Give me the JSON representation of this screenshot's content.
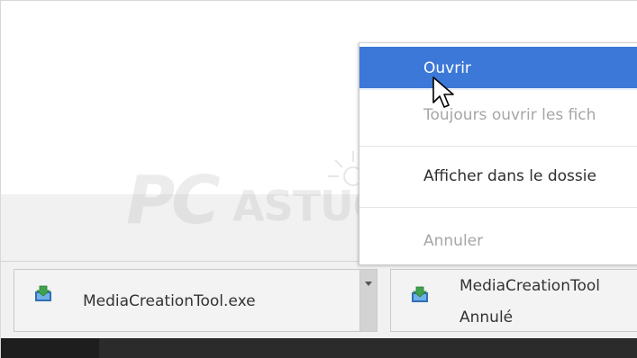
{
  "context_menu": {
    "open": "Ouvrir",
    "always_open": "Toujours ouvrir les fich",
    "show_in_folder": "Afficher dans le dossie",
    "cancel": "Annuler"
  },
  "watermark": {
    "brand_main": "PC",
    "brand_sub": "ASTUCES"
  },
  "downloads": [
    {
      "file_name": "MediaCreationTool.exe",
      "status": "",
      "icon": "installer-file-icon"
    },
    {
      "file_name": "MediaCreationTool",
      "status": "Annulé",
      "icon": "installer-file-icon"
    }
  ],
  "colors": {
    "menu_highlight": "#3c78d7",
    "disabled_text": "#a6a6a6",
    "shelf_background": "#f1f1f1",
    "taskbar": "#2b2b2b"
  }
}
